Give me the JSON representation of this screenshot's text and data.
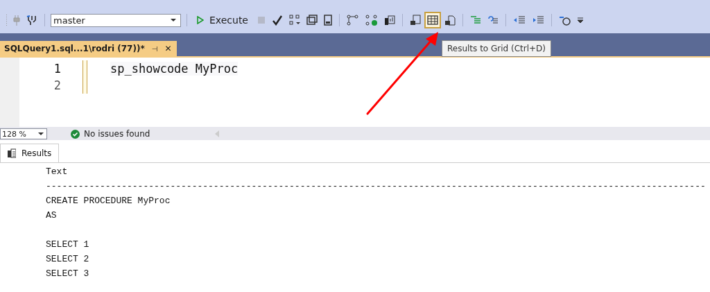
{
  "query_toolbar": {
    "database": "master",
    "execute_label": "Execute",
    "results_to_grid_highlighted": true
  },
  "tooltip": "Results to Grid (Ctrl+D)",
  "document_tab": {
    "title": "SQLQuery1.sql...1\\rodri (77))*",
    "pin": "⊣",
    "close": "✕",
    "selected": true
  },
  "editor": {
    "lines": [
      {
        "number": "1",
        "code": "sp_showcode MyProc"
      },
      {
        "number": "2"
      }
    ]
  },
  "status": {
    "zoom": "128 %",
    "issues": "No issues found"
  },
  "results_tab": {
    "label": "Results",
    "selected": true
  },
  "results_blocks": [
    [
      "Text",
      "--------------------------------------------------------------------------------------------------------------------------",
      "CREATE PROCEDURE MyProc",
      "AS"
    ],
    [
      "SELECT 1",
      "SELECT 2",
      "SELECT 3"
    ]
  ]
}
